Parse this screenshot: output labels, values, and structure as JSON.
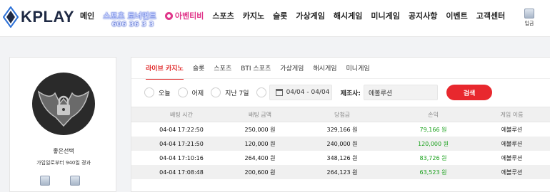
{
  "header": {
    "logo_text": "KPLAY",
    "nav": {
      "main": "메인",
      "tournament": "스포츠 토너먼트",
      "tournament_countdown": "606 36 3 3",
      "live": "아벤티비",
      "sports": "스포츠",
      "casino": "카지노",
      "slot": "슬롯",
      "virtual": "가상게임",
      "hash": "해시게임",
      "mini": "미니게임",
      "notice": "공지사항",
      "event": "이벤트",
      "support": "고객센터"
    },
    "login_label": "입금"
  },
  "profile": {
    "name": "좋은선택",
    "subtitle": "가입일로부터 940일 경과"
  },
  "tabs": [
    "라이브 카지노",
    "슬롯",
    "스포츠",
    "BTI 스포츠",
    "가상게임",
    "해시게임",
    "미니게임"
  ],
  "filters": {
    "today": "오늘",
    "yesterday": "어제",
    "last7": "지난 7일",
    "date_range": "04/04 - 04/04",
    "maker_label": "제조사:",
    "maker_value": "에볼루션",
    "search_label": "검색"
  },
  "table": {
    "headers": [
      "배팅 시간",
      "배팅 금액",
      "당첨금",
      "손익",
      "게임 이름"
    ],
    "rows": [
      [
        "04-04 17:22:50",
        "250,000 원",
        "329,166 원",
        "79,166 원",
        "에볼루션"
      ],
      [
        "04-04 17:21:50",
        "120,000 원",
        "240,000 원",
        "120,000 원",
        "에볼루션"
      ],
      [
        "04-04 17:10:16",
        "264,400 원",
        "348,126 원",
        "83,726 원",
        "에볼루션"
      ],
      [
        "04-04 17:08:48",
        "200,600 원",
        "264,123 원",
        "63,523 원",
        "에볼루션"
      ]
    ]
  },
  "colors": {
    "accent": "#e8282e",
    "live": "#e0368a",
    "profit": "#18a01a"
  }
}
